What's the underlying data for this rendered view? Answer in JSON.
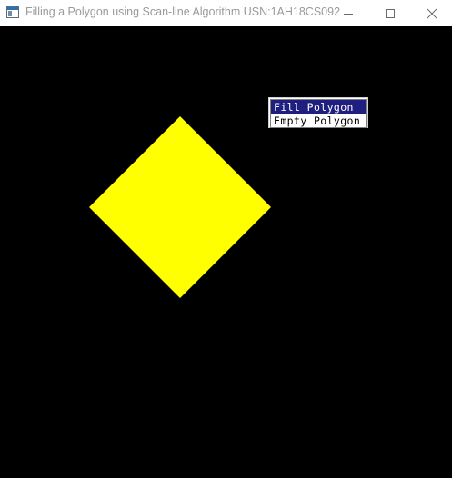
{
  "window": {
    "title": "Filling a Polygon using Scan-line Algorithm USN:1AH18CS092",
    "controls": {
      "minimize_icon": "minimize-icon",
      "maximize_icon": "maximize-icon",
      "close_icon": "close-icon"
    }
  },
  "canvas": {
    "background": "#000000",
    "polygon": {
      "shape": "diamond",
      "fill_color": "#ffff00",
      "state": "filled"
    }
  },
  "menu": {
    "items": [
      {
        "label": "Fill Polygon",
        "selected": true
      },
      {
        "label": "Empty Polygon",
        "selected": false
      }
    ],
    "highlight_color": "#1f1f7f"
  }
}
